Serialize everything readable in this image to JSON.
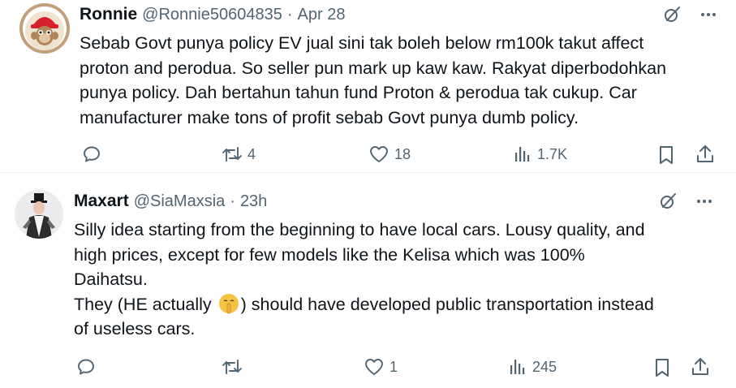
{
  "tweets": [
    {
      "name": "Ronnie",
      "handle": "@Ronnie50604835",
      "separator": "·",
      "time": "Apr 28",
      "lines": [
        "Sebab Govt punya policy EV jual sini tak boleh below rm100k takut affect",
        "proton and perodua. So seller pun mark up kaw kaw. Rakyat diperbodohkan",
        "punya policy. Dah bertahun tahun fund Proton & perodua tak cukup. Car",
        "manufacturer make tons of profit sebab Govt punya dumb policy."
      ],
      "stats": {
        "replies": "",
        "reposts": "4",
        "likes": "18",
        "views": "1.7K"
      }
    },
    {
      "name": "Maxart",
      "handle": "@SiaMaxsia",
      "separator": "·",
      "time": "23h",
      "lines": [
        "Silly idea starting from the beginning to have local cars. Lousy quality, and",
        "high prices, except for few models like the Kelisa which was 100%",
        "Daihatsu."
      ],
      "line4_pre": "They (HE actually ",
      "line4_post": ") should have developed public transportation instead",
      "line5": "of useless cars.",
      "stats": {
        "replies": "",
        "reposts": "",
        "likes": "1",
        "views": "245"
      }
    }
  ],
  "icons": [
    "avatar",
    "grok-icon",
    "more-icon",
    "reply-icon",
    "repost-icon",
    "like-icon",
    "views-icon",
    "bookmark-icon",
    "share-icon",
    "shushing-face-emoji"
  ],
  "colors": {
    "text": "#0f1419",
    "secondary": "#536471",
    "divider": "#eff3f4"
  }
}
